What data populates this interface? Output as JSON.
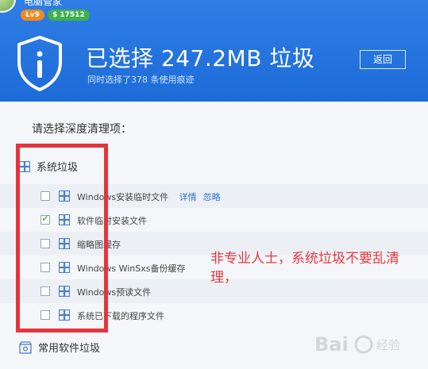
{
  "header": {
    "app_name": "电脑管家",
    "level": "Lv9",
    "coins": "$ 17512",
    "title": "已选择 247.2MB 垃圾",
    "subtitle": "同时选择了378 条使用痕迹",
    "back_label": "返回"
  },
  "content": {
    "prompt": "请选择深度清理项：",
    "section_system": "系统垃圾",
    "rows": [
      {
        "label": "Windows安装临时文件",
        "checked": false,
        "links": [
          "详情",
          "忽略"
        ]
      },
      {
        "label": "软件临时安装文件",
        "checked": true
      },
      {
        "label": "缩略图缓存",
        "checked": false
      },
      {
        "label": "Windows WinSxs备份缓存",
        "checked": false
      },
      {
        "label": "Windows预读文件",
        "checked": false
      },
      {
        "label": "系统已下载的程序文件",
        "checked": false
      }
    ],
    "section_software": "常用软件垃圾"
  },
  "annotation": {
    "note": "非专业人士，系统垃圾不要乱清理，"
  },
  "colors": {
    "header_blue": "#1d6bd7",
    "annotation_red": "#e5343c",
    "link_blue": "#2b73d6"
  },
  "icons": {
    "shield": "shield-icon",
    "windows": "windows-icon",
    "box": "box-icon"
  }
}
